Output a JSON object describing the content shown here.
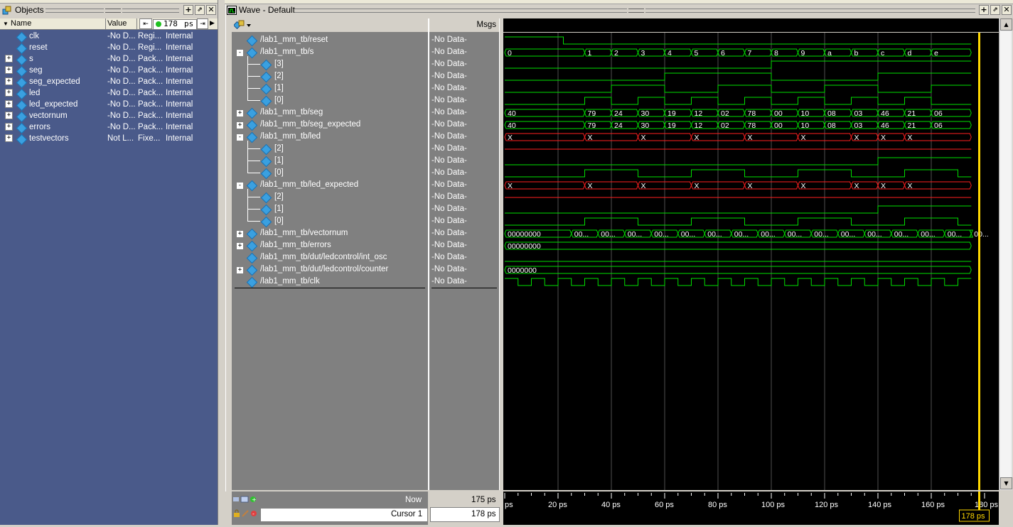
{
  "objects": {
    "title": "Objects",
    "time_value": "178",
    "time_unit": "ps",
    "columns": {
      "name": "Name",
      "value": "Value",
      "kind": ""
    },
    "rows": [
      {
        "name": "clk",
        "value": "-No D...",
        "kind": "Regi...",
        "mode": "Internal",
        "expandable": false
      },
      {
        "name": "reset",
        "value": "-No D...",
        "kind": "Regi...",
        "mode": "Internal",
        "expandable": false
      },
      {
        "name": "s",
        "value": "-No D...",
        "kind": "Pack...",
        "mode": "Internal",
        "expandable": true
      },
      {
        "name": "seg",
        "value": "-No D...",
        "kind": "Pack...",
        "mode": "Internal",
        "expandable": true
      },
      {
        "name": "seg_expected",
        "value": "-No D...",
        "kind": "Pack...",
        "mode": "Internal",
        "expandable": true
      },
      {
        "name": "led",
        "value": "-No D...",
        "kind": "Pack...",
        "mode": "Internal",
        "expandable": true
      },
      {
        "name": "led_expected",
        "value": "-No D...",
        "kind": "Pack...",
        "mode": "Internal",
        "expandable": true
      },
      {
        "name": "vectornum",
        "value": "-No D...",
        "kind": "Pack...",
        "mode": "Internal",
        "expandable": true
      },
      {
        "name": "errors",
        "value": "-No D...",
        "kind": "Pack...",
        "mode": "Internal",
        "expandable": true
      },
      {
        "name": "testvectors",
        "value": "Not L...",
        "kind": "Fixe...",
        "mode": "Internal",
        "expandable": true
      }
    ]
  },
  "wave": {
    "title": "Wave - Default",
    "msgs_header": "Msgs",
    "signals": [
      {
        "label": "/lab1_mm_tb/reset",
        "indent": 0,
        "toggle": "",
        "msg": "-No Data-"
      },
      {
        "label": "/lab1_mm_tb/s",
        "indent": 0,
        "toggle": "-",
        "msg": "-No Data-"
      },
      {
        "label": "[3]",
        "indent": 1,
        "toggle": "",
        "msg": "-No Data-"
      },
      {
        "label": "[2]",
        "indent": 1,
        "toggle": "",
        "msg": "-No Data-"
      },
      {
        "label": "[1]",
        "indent": 1,
        "toggle": "",
        "msg": "-No Data-"
      },
      {
        "label": "[0]",
        "indent": 1,
        "toggle": "",
        "msg": "-No Data-"
      },
      {
        "label": "/lab1_mm_tb/seg",
        "indent": 0,
        "toggle": "+",
        "msg": "-No Data-"
      },
      {
        "label": "/lab1_mm_tb/seg_expected",
        "indent": 0,
        "toggle": "+",
        "msg": "-No Data-"
      },
      {
        "label": "/lab1_mm_tb/led",
        "indent": 0,
        "toggle": "-",
        "msg": "-No Data-"
      },
      {
        "label": "[2]",
        "indent": 1,
        "toggle": "",
        "msg": "-No Data-"
      },
      {
        "label": "[1]",
        "indent": 1,
        "toggle": "",
        "msg": "-No Data-"
      },
      {
        "label": "[0]",
        "indent": 1,
        "toggle": "",
        "msg": "-No Data-"
      },
      {
        "label": "/lab1_mm_tb/led_expected",
        "indent": 0,
        "toggle": "-",
        "msg": "-No Data-"
      },
      {
        "label": "[2]",
        "indent": 1,
        "toggle": "",
        "msg": "-No Data-"
      },
      {
        "label": "[1]",
        "indent": 1,
        "toggle": "",
        "msg": "-No Data-"
      },
      {
        "label": "[0]",
        "indent": 1,
        "toggle": "",
        "msg": "-No Data-"
      },
      {
        "label": "/lab1_mm_tb/vectornum",
        "indent": 0,
        "toggle": "+",
        "msg": "-No Data-"
      },
      {
        "label": "/lab1_mm_tb/errors",
        "indent": 0,
        "toggle": "+",
        "msg": "-No Data-"
      },
      {
        "label": "/lab1_mm_tb/dut/ledcontrol/int_osc",
        "indent": 0,
        "toggle": "",
        "msg": "-No Data-"
      },
      {
        "label": "/lab1_mm_tb/dut/ledcontrol/counter",
        "indent": 0,
        "toggle": "+",
        "msg": "-No Data-"
      },
      {
        "label": "/lab1_mm_tb/clk",
        "indent": 0,
        "toggle": "",
        "msg": "-No Data-"
      }
    ],
    "bus_values": {
      "s": [
        "0",
        "1",
        "2",
        "3",
        "4",
        "5",
        "6",
        "7",
        "8",
        "9",
        "a",
        "b",
        "c",
        "d",
        "e"
      ],
      "seg": [
        "40",
        "79",
        "24",
        "30",
        "19",
        "12",
        "02",
        "78",
        "00",
        "10",
        "08",
        "03",
        "46",
        "21",
        "06"
      ],
      "seg_expected": [
        "40",
        "79",
        "24",
        "30",
        "19",
        "12",
        "02",
        "78",
        "00",
        "10",
        "08",
        "03",
        "46",
        "21",
        "06"
      ],
      "led": [
        "X",
        "X",
        "X",
        "X",
        "X",
        "X",
        "X",
        "X",
        "X"
      ],
      "led_expected": [
        "X",
        "X",
        "X",
        "X",
        "X",
        "X",
        "X",
        "X",
        "X"
      ],
      "vectornum_first": "00000000",
      "vectornum_rest": "00...",
      "errors": "00000000",
      "counter": "0000000"
    },
    "now_label": "Now",
    "now_value": "175 ps",
    "cursor_label": "Cursor 1",
    "cursor_value": "178 ps",
    "cursor_flag": "178 ps",
    "ticks": [
      "ps",
      "20 ps",
      "40 ps",
      "60 ps",
      "80 ps",
      "100 ps",
      "120 ps",
      "140 ps",
      "160 ps",
      "180 ps"
    ],
    "colors": {
      "wave": "#00e000",
      "x_state": "#ff2020",
      "cursor": "#ffd800",
      "bg": "#000000"
    }
  }
}
